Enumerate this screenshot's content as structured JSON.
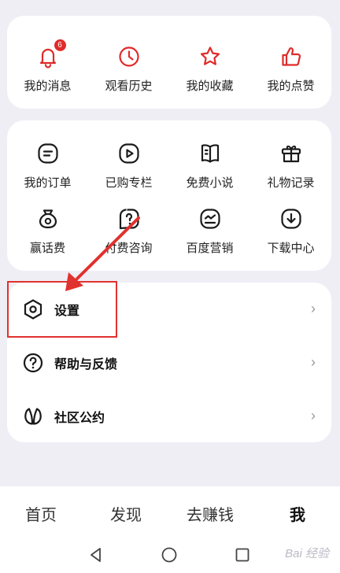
{
  "top_card": {
    "items": [
      {
        "label": "我的消息",
        "icon": "bell-icon",
        "badge": "6"
      },
      {
        "label": "观看历史",
        "icon": "clock-icon"
      },
      {
        "label": "我的收藏",
        "icon": "star-icon"
      },
      {
        "label": "我的点赞",
        "icon": "thumbs-up-icon"
      }
    ]
  },
  "services": {
    "row1": [
      {
        "label": "我的订单",
        "icon": "order-icon"
      },
      {
        "label": "已购专栏",
        "icon": "play-icon"
      },
      {
        "label": "免费小说",
        "icon": "book-icon"
      },
      {
        "label": "礼物记录",
        "icon": "gift-icon"
      }
    ],
    "row2": [
      {
        "label": "赢话费",
        "icon": "money-bag-icon"
      },
      {
        "label": "付费咨询",
        "icon": "question-icon"
      },
      {
        "label": "百度营销",
        "icon": "chart-icon"
      },
      {
        "label": "下载中心",
        "icon": "download-icon"
      }
    ]
  },
  "menu": {
    "items": [
      {
        "label": "设置",
        "icon": "settings-icon"
      },
      {
        "label": "帮助与反馈",
        "icon": "help-icon"
      },
      {
        "label": "社区公约",
        "icon": "leaf-icon"
      }
    ],
    "chevron": "›"
  },
  "tabbar": {
    "tabs": [
      "首页",
      "发现",
      "去赚钱",
      "我"
    ],
    "active_index": 3
  },
  "watermark": "Bai 经验",
  "colors": {
    "red": "#e02a2a",
    "background": "#f0eef5",
    "card": "#ffffff"
  }
}
